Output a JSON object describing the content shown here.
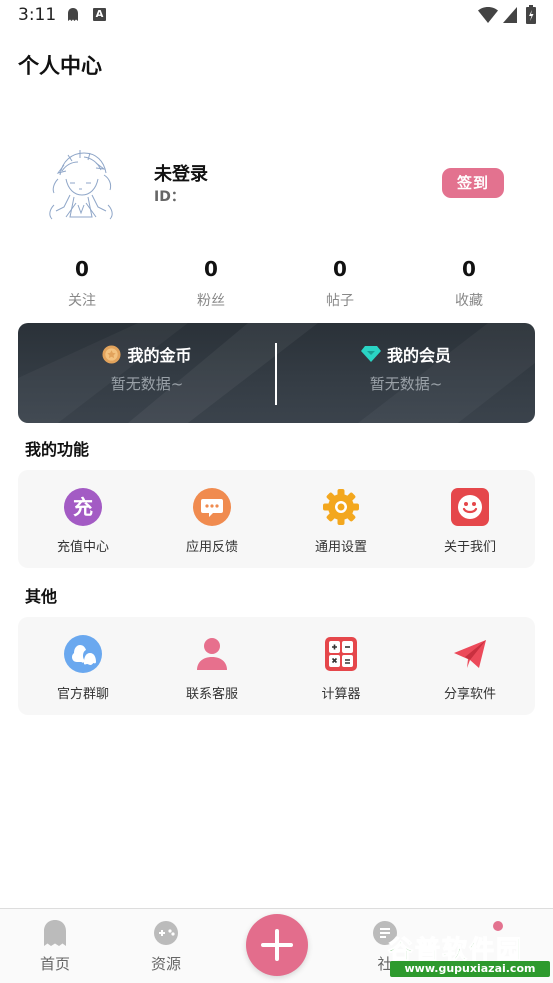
{
  "status_bar": {
    "time": "3:11",
    "keyboard_badge": "A"
  },
  "page": {
    "title": "个人中心"
  },
  "profile": {
    "name": "未登录",
    "id_label": "ID：",
    "checkin_label": "签到"
  },
  "stats": [
    {
      "value": "0",
      "label": "关注"
    },
    {
      "value": "0",
      "label": "粉丝"
    },
    {
      "value": "0",
      "label": "帖子"
    },
    {
      "value": "0",
      "label": "收藏"
    }
  ],
  "wallet": {
    "coins": {
      "title": "我的金币",
      "value": "暂无数据~"
    },
    "membership": {
      "title": "我的会员",
      "value": "暂无数据~"
    }
  },
  "features": {
    "title": "我的功能",
    "items": [
      {
        "label": "充值中心",
        "icon": "recharge-icon",
        "glyph": "充",
        "color": "#a35bc4"
      },
      {
        "label": "应用反馈",
        "icon": "feedback-icon",
        "color": "#f08b4f"
      },
      {
        "label": "通用设置",
        "icon": "settings-gear-icon",
        "color": "#f3a71e"
      },
      {
        "label": "关于我们",
        "icon": "about-smiley-icon",
        "color": "#e5474b"
      }
    ]
  },
  "others": {
    "title": "其他",
    "items": [
      {
        "label": "官方群聊",
        "icon": "group-chat-icon",
        "color": "#6aa8ef"
      },
      {
        "label": "联系客服",
        "icon": "customer-service-icon",
        "color": "#e7708d"
      },
      {
        "label": "计算器",
        "icon": "calculator-icon",
        "color": "#e5474b"
      },
      {
        "label": "分享软件",
        "icon": "share-paper-plane-icon",
        "color": "#ec4a5a"
      }
    ]
  },
  "bottom_nav": {
    "tabs": [
      {
        "label": "首页",
        "icon": "ghost-home-icon"
      },
      {
        "label": "资源",
        "icon": "gamepad-icon"
      },
      {
        "label": "社",
        "icon": "community-icon"
      }
    ],
    "add_icon": "plus-icon"
  },
  "watermark": {
    "title": "谷普软件园",
    "url": "www.gupuxiazai.com"
  },
  "colors": {
    "accent": "#e3728f",
    "card_bg": "#f7f7f7",
    "wallet_bg": "#2f373f"
  }
}
